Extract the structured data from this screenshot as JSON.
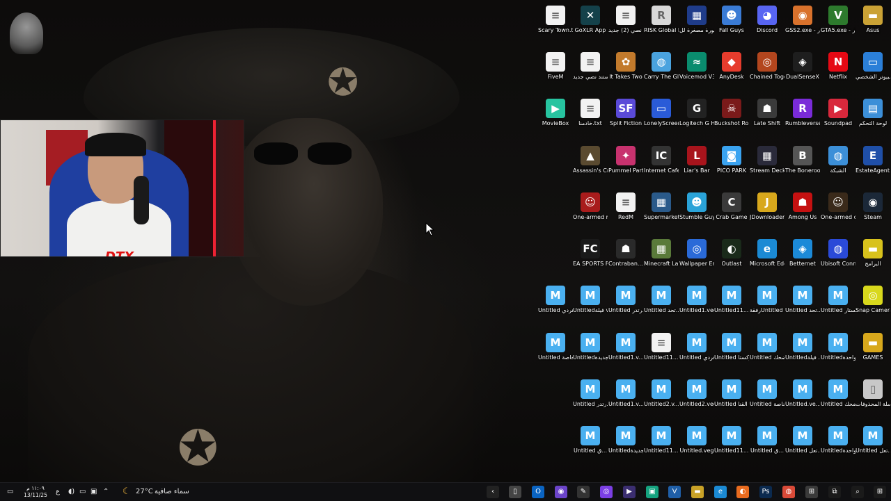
{
  "taskbar": {
    "clock_time": "١١:٠٩ م",
    "clock_date": "13/11/25",
    "language": "ع",
    "temperature": "27°C",
    "weather_text": "سماء صافية",
    "apps": [
      {
        "name": "chevron-app",
        "glyph": "‹",
        "color": "#222"
      },
      {
        "name": "file",
        "glyph": "▯",
        "color": "#444"
      },
      {
        "name": "outlook",
        "glyph": "O",
        "color": "#0a64c2"
      },
      {
        "name": "discord-ish",
        "glyph": "◉",
        "color": "#6b44c9"
      },
      {
        "name": "edit",
        "glyph": "✎",
        "color": "#333"
      },
      {
        "name": "obs",
        "glyph": "◎",
        "color": "#7b3fe4"
      },
      {
        "name": "media",
        "glyph": "▶",
        "color": "#3b2e70"
      },
      {
        "name": "clipchamp",
        "glyph": "▣",
        "color": "#15a37f"
      },
      {
        "name": "vegas",
        "glyph": "V",
        "color": "#1f5fa8"
      },
      {
        "name": "folder",
        "glyph": "▬",
        "color": "#c9a227"
      },
      {
        "name": "edge",
        "glyph": "e",
        "color": "#1b8ad4"
      },
      {
        "name": "firefox",
        "glyph": "◐",
        "color": "#e86b1f"
      },
      {
        "name": "photoshop",
        "glyph": "Ps",
        "color": "#0b2a4f"
      },
      {
        "name": "chrome",
        "glyph": "◍",
        "color": "#d94a38"
      },
      {
        "name": "gamepad",
        "glyph": "⊞",
        "color": "#3a3a3a"
      },
      {
        "name": "task-view",
        "glyph": "⧉",
        "color": "#1a1a1a"
      },
      {
        "name": "search",
        "glyph": "⌕",
        "color": "#1a1a1a"
      },
      {
        "name": "start",
        "glyph": "⊞",
        "color": "#1a1a1a"
      }
    ]
  },
  "icons": [
    {
      "label": "Asus",
      "color": "#caa235",
      "glyph": "▬"
    },
    {
      "label": "GTA5.exe - اختصار",
      "color": "#2d7a2d",
      "glyph": "V"
    },
    {
      "label": "GSS2.exe - اختصار",
      "color": "#d9722c",
      "glyph": "◉"
    },
    {
      "label": "Discord",
      "color": "#5865f2",
      "glyph": "◕"
    },
    {
      "label": "Fall Guys",
      "color": "#3a7bd5",
      "glyph": "☻"
    },
    {
      "label": "صورة صورة مصغرة لل",
      "color": "#1f3c8a",
      "glyph": "▦"
    },
    {
      "label": "RISK Global Domination",
      "color": "#d8d8d8",
      "glyph": "R"
    },
    {
      "label": "مستند نصي (2) جديد.txt",
      "color": "#f2f2f2",
      "glyph": "≡"
    },
    {
      "label": "GoXLR App",
      "color": "#14414a",
      "glyph": "✕"
    },
    {
      "label": "Scary Town.txt",
      "color": "#f2f2f2",
      "glyph": "≡"
    },
    {
      "label": "هذا الكمبيوتر الشخصي",
      "color": "#2b7fd8",
      "glyph": "▭"
    },
    {
      "label": "Netflix",
      "color": "#e50914",
      "glyph": "N"
    },
    {
      "label": "DualSenseX",
      "color": "#1e1e1e",
      "glyph": "◈"
    },
    {
      "label": "Chained Together",
      "color": "#b3461e",
      "glyph": "◎"
    },
    {
      "label": "AnyDesk",
      "color": "#e63c2d",
      "glyph": "◆"
    },
    {
      "label": "Voicemod V3",
      "color": "#0a8c6e",
      "glyph": "≈"
    },
    {
      "label": "Carry The Glass",
      "color": "#4aa3df",
      "glyph": "◍"
    },
    {
      "label": "It Takes Two",
      "color": "#c27a2c",
      "glyph": "✿"
    },
    {
      "label": "مستند نصي جديد.txt",
      "color": "#f2f2f2",
      "glyph": "≡"
    },
    {
      "label": "FiveM",
      "color": "#f2f2f2",
      "glyph": "≡"
    },
    {
      "label": "لوحة التحكم",
      "color": "#3c8fd8",
      "glyph": "▤"
    },
    {
      "label": "Soundpad",
      "color": "#d8283c",
      "glyph": "▶"
    },
    {
      "label": "Rumbleverse",
      "color": "#7a2bd8",
      "glyph": "R"
    },
    {
      "label": "Late Shift",
      "color": "#3a3a3a",
      "glyph": "☗"
    },
    {
      "label": "Buckshot Roulette",
      "color": "#7a1a1a",
      "glyph": "☠"
    },
    {
      "label": "Logitech G HUB",
      "color": "#222",
      "glyph": "G"
    },
    {
      "label": "LonelyScreen",
      "color": "#2a5bd8",
      "glyph": "▭"
    },
    {
      "label": "Split Fiction",
      "color": "#5a4ad8",
      "glyph": "SF"
    },
    {
      "label": "خادمنا.txt",
      "color": "#f2f2f2",
      "glyph": "≡"
    },
    {
      "label": "MovieBox",
      "color": "#27c4a0",
      "glyph": "▶"
    },
    {
      "label": "EstateAgent... - اختصار",
      "color": "#1f4fa8",
      "glyph": "E"
    },
    {
      "label": "الشبكة",
      "color": "#3c8fd8",
      "glyph": "◍"
    },
    {
      "label": "The Bonerooms",
      "color": "#555",
      "glyph": "B"
    },
    {
      "label": "Stream Deck",
      "color": "#2a2a3a",
      "glyph": "▦"
    },
    {
      "label": "PICO PARK",
      "color": "#3aa3f0",
      "glyph": "◙"
    },
    {
      "label": "Liar's Bar",
      "color": "#a8141c",
      "glyph": "L"
    },
    {
      "label": "Internet Cafe Simulator 2...",
      "color": "#333",
      "glyph": "IC"
    },
    {
      "label": "Pummel Party",
      "color": "#c8326e",
      "glyph": "✦"
    },
    {
      "label": "Assassin's Creed Mirage",
      "color": "#5a4a30",
      "glyph": "▲"
    },
    {
      "label": "Steam",
      "color": "#1b2838",
      "glyph": "◉"
    },
    {
      "label": "One-armed cook",
      "color": "#3a2a1a",
      "glyph": "☺"
    },
    {
      "label": "Among Us",
      "color": "#c51111",
      "glyph": "☗"
    },
    {
      "label": "JDownloader 2",
      "color": "#d8a81c",
      "glyph": "J"
    },
    {
      "label": "Crab Game",
      "color": "#3a3a3a",
      "glyph": "C"
    },
    {
      "label": "Stumble Guys",
      "color": "#2aa3d8",
      "glyph": "☻"
    },
    {
      "label": "Supermarket Simulator.e...",
      "color": "#2a5a8a",
      "glyph": "▦"
    },
    {
      "label": "RedM",
      "color": "#f2f2f2",
      "glyph": "≡"
    },
    {
      "label": "One-armed robber",
      "color": "#a81c1c",
      "glyph": "☺"
    },
    {
      "label": "البرامج",
      "color": "#d8c21c",
      "glyph": "▬"
    },
    {
      "label": "Ubisoft Connect",
      "color": "#2a4ad8",
      "glyph": "◍"
    },
    {
      "label": "Betternet",
      "color": "#1c8ad8",
      "glyph": "◈"
    },
    {
      "label": "Microsoft Edge",
      "color": "#1b8ad4",
      "glyph": "e"
    },
    {
      "label": "Outlast",
      "color": "#1a2a1a",
      "glyph": "◐"
    },
    {
      "label": "Wallpaper Engine",
      "color": "#2a6ad8",
      "glyph": "◎"
    },
    {
      "label": "Minecraft Launcher",
      "color": "#5a7a3a",
      "glyph": "▦"
    },
    {
      "label": "Contraban... - اختصار",
      "color": "#2a2a2a",
      "glyph": "☗"
    },
    {
      "label": "EA SPORTS FC 26",
      "color": "#1a1a1a",
      "glyph": "FC"
    },
    {
      "label": "Snap Camera",
      "color": "#d8d81c",
      "glyph": "◎"
    },
    {
      "label": "Untitled روكستار.veg",
      "color": "#4ab0f0",
      "glyph": "M"
    },
    {
      "label": "Untitled تحد...",
      "color": "#4ab0f0",
      "glyph": "M"
    },
    {
      "label": "رفقةUntitled فعل القناة...",
      "color": "#4ab0f0",
      "glyph": "M"
    },
    {
      "label": "Untitled11... واحدة.veg.bak",
      "color": "#4ab0f0",
      "glyph": "M"
    },
    {
      "label": "Untitled1.veg",
      "color": "#4ab0f0",
      "glyph": "M"
    },
    {
      "label": "Untitled تحد...",
      "color": "#4ab0f0",
      "glyph": "M"
    },
    {
      "label": "Untitled رتدر...",
      "color": "#4ab0f0",
      "glyph": "M"
    },
    {
      "label": "Untitledفيلة veg.bak",
      "color": "#4ab0f0",
      "glyph": "M"
    },
    {
      "label": "Untitled قراند فردي.veg",
      "color": "#4ab0f0",
      "glyph": "M"
    },
    {
      "label": "GAMES",
      "color": "#d8a81c",
      "glyph": "▬"
    },
    {
      "label": "Untitledدقيقة واحدة.veg.bak",
      "color": "#4ab0f0",
      "glyph": "M"
    },
    {
      "label": "Untitledفيلة .veg",
      "color": "#4ab0f0",
      "glyph": "M"
    },
    {
      "label": "Untitled تحدي الضحك...",
      "color": "#4ab0f0",
      "glyph": "M"
    },
    {
      "label": "Untitled روكستا...",
      "color": "#4ab0f0",
      "glyph": "M"
    },
    {
      "label": "Untitled قراند فردي.veg.bak",
      "color": "#4ab0f0",
      "glyph": "M"
    },
    {
      "label": "Untitled11... واحدة.veg.b...",
      "color": "#f2f2f2",
      "glyph": "≡"
    },
    {
      "label": "Untitled1.v...",
      "color": "#4ab0f0",
      "glyph": "M"
    },
    {
      "label": "Untitledمقا... جديدة.veg...",
      "color": "#4ab0f0",
      "glyph": "M"
    },
    {
      "label": "Untitled حلقة خاصة.veg.bak",
      "color": "#4ab0f0",
      "glyph": "M"
    },
    {
      "label": "سلة المحذوفات",
      "color": "#c8c8c8",
      "glyph": "▯"
    },
    {
      "label": "Untitled تحدي الضحك.veg",
      "color": "#4ab0f0",
      "glyph": "M"
    },
    {
      "label": "Untitled.ve...",
      "color": "#4ab0f0",
      "glyph": "M"
    },
    {
      "label": "Untitled حلقة خاصة.veg",
      "color": "#4ab0f0",
      "glyph": "M"
    },
    {
      "label": "Untitled رفقة فعل القنا...",
      "color": "#4ab0f0",
      "glyph": "M"
    },
    {
      "label": "Untitled2.veg",
      "color": "#4ab0f0",
      "glyph": "M"
    },
    {
      "label": "Untitled2.v...",
      "color": "#4ab0f0",
      "glyph": "M"
    },
    {
      "label": "Untitled1.v...",
      "color": "#4ab0f0",
      "glyph": "M"
    },
    {
      "label": "Untitled رتدر...",
      "color": "#4ab0f0",
      "glyph": "M"
    },
    {
      "label": "Untitled تعل...",
      "color": "#4ab0f0",
      "glyph": "M"
    },
    {
      "label": "Untitledدقيقة واحدة.veg",
      "color": "#4ab0f0",
      "glyph": "M"
    },
    {
      "label": "Untitled تعل...",
      "color": "#4ab0f0",
      "glyph": "M"
    },
    {
      "label": "Untitled ق...",
      "color": "#4ab0f0",
      "glyph": "M"
    },
    {
      "label": "Untitled11... واحدة.veg",
      "color": "#4ab0f0",
      "glyph": "M"
    },
    {
      "label": "Untitled.veg",
      "color": "#4ab0f0",
      "glyph": "M"
    },
    {
      "label": "Untitled11... واحدة.veg.b...",
      "color": "#4ab0f0",
      "glyph": "M"
    },
    {
      "label": "Untitledمقا... جديدة.veg",
      "color": "#4ab0f0",
      "glyph": "M"
    },
    {
      "label": "Untitled ق...",
      "color": "#4ab0f0",
      "glyph": "M"
    }
  ]
}
